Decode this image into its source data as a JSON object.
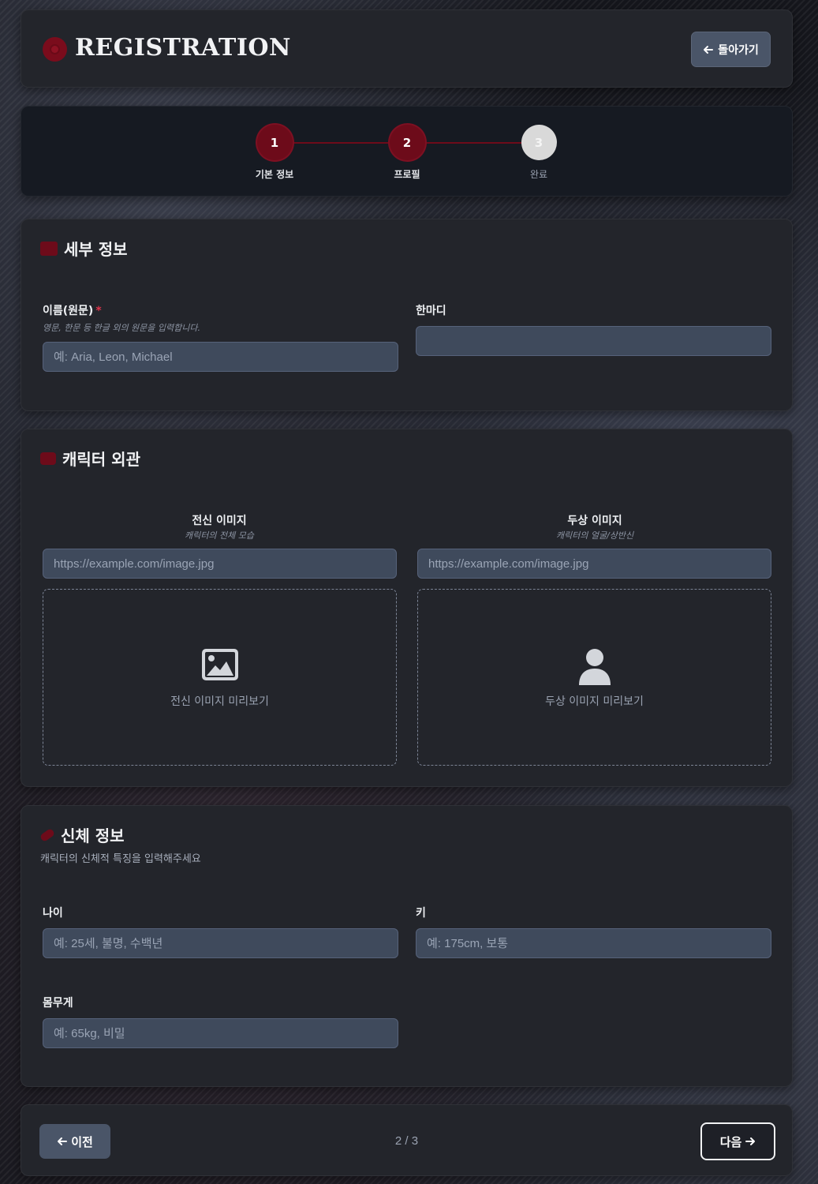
{
  "header": {
    "title": "REGISTRATION",
    "back_label": "돌아가기"
  },
  "steps": [
    {
      "number": "1",
      "label": "기본 정보",
      "state": "done"
    },
    {
      "number": "2",
      "label": "프로필",
      "state": "done"
    },
    {
      "number": "3",
      "label": "완료",
      "state": "pending"
    }
  ],
  "details": {
    "title": "세부 정보",
    "name_label": "이름(원문)",
    "name_required": "*",
    "name_hint": "영문, 한문 등 한글 외의 원문을 입력합니다.",
    "name_placeholder": "예: Aria, Leon, Michael",
    "name_value": "",
    "quote_label": "한마디",
    "quote_value": ""
  },
  "appearance": {
    "title": "캐릭터 외관",
    "full": {
      "title": "전신 이미지",
      "hint": "캐릭터의 전체 모습",
      "placeholder": "https://example.com/image.jpg",
      "preview_text": "전신 이미지 미리보기"
    },
    "head": {
      "title": "두상 이미지",
      "hint": "캐릭터의 얼굴/상반신",
      "placeholder": "https://example.com/image.jpg",
      "preview_text": "두상 이미지 미리보기"
    }
  },
  "body": {
    "title": "신체 정보",
    "subtitle": "캐릭터의 신체적 특징을 입력해주세요",
    "age_label": "나이",
    "age_placeholder": "예: 25세, 불명, 수백년",
    "height_label": "키",
    "height_placeholder": "예: 175cm, 보통",
    "weight_label": "몸무게",
    "weight_placeholder": "예: 65kg, 비밀"
  },
  "footer": {
    "prev_label": "이전",
    "page_indicator": "2 / 3",
    "next_label": "다음"
  },
  "colors": {
    "accent": "#6d0b1a",
    "card": "#23252b",
    "input": "#3f4a5c"
  }
}
